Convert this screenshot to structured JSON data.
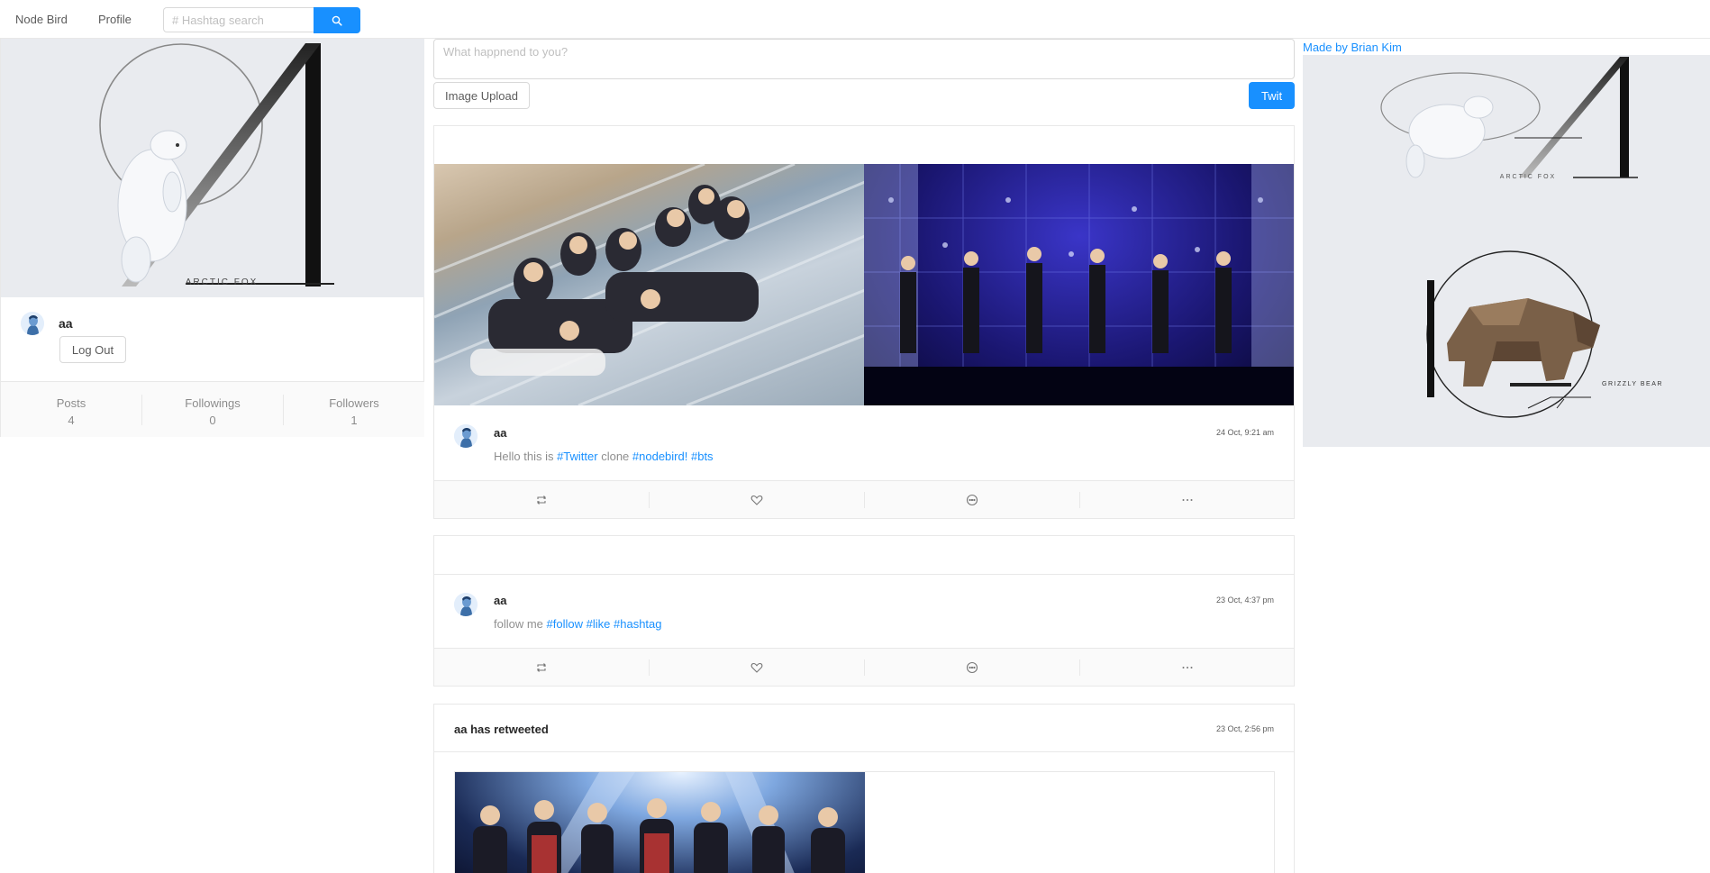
{
  "nav": {
    "brand": "Node Bird",
    "profile": "Profile",
    "search_placeholder": "# Hashtag search"
  },
  "profile_card": {
    "cover_caption": "ARCTIC FOX",
    "username": "aa",
    "logout_label": "Log Out",
    "stats": [
      {
        "label": "Posts",
        "value": "4"
      },
      {
        "label": "Followings",
        "value": "0"
      },
      {
        "label": "Followers",
        "value": "1"
      }
    ]
  },
  "compose": {
    "placeholder": "What happnend to you?",
    "image_upload_label": "Image Upload",
    "submit_label": "Twit"
  },
  "posts": [
    {
      "username": "aa",
      "date": "24 Oct, 9:21 am",
      "text_prefix": "Hello this is ",
      "tag1": "#Twitter",
      "text_mid": " clone ",
      "tag2": "#nodebird!",
      "tag3": "#bts"
    },
    {
      "username": "aa",
      "date": "23 Oct, 4:37 pm",
      "text_prefix": "follow me ",
      "tag1": "#follow",
      "tag2": "#like",
      "tag3": "#hashtag"
    },
    {
      "retweet_label": "aa has retweeted",
      "date": "23 Oct, 2:56 pm"
    }
  ],
  "sidebar": {
    "credit": "Made by Brian Kim",
    "caption_top": "ARCTIC FOX",
    "caption_bottom": "GRIZZLY BEAR"
  },
  "icons": [
    "search-icon",
    "retweet-icon",
    "heart-icon",
    "message-icon",
    "ellipsis-icon"
  ],
  "colors": {
    "accent": "#1890ff",
    "cover_bg": "#e9ebef",
    "action_bar": "#fafafa"
  }
}
